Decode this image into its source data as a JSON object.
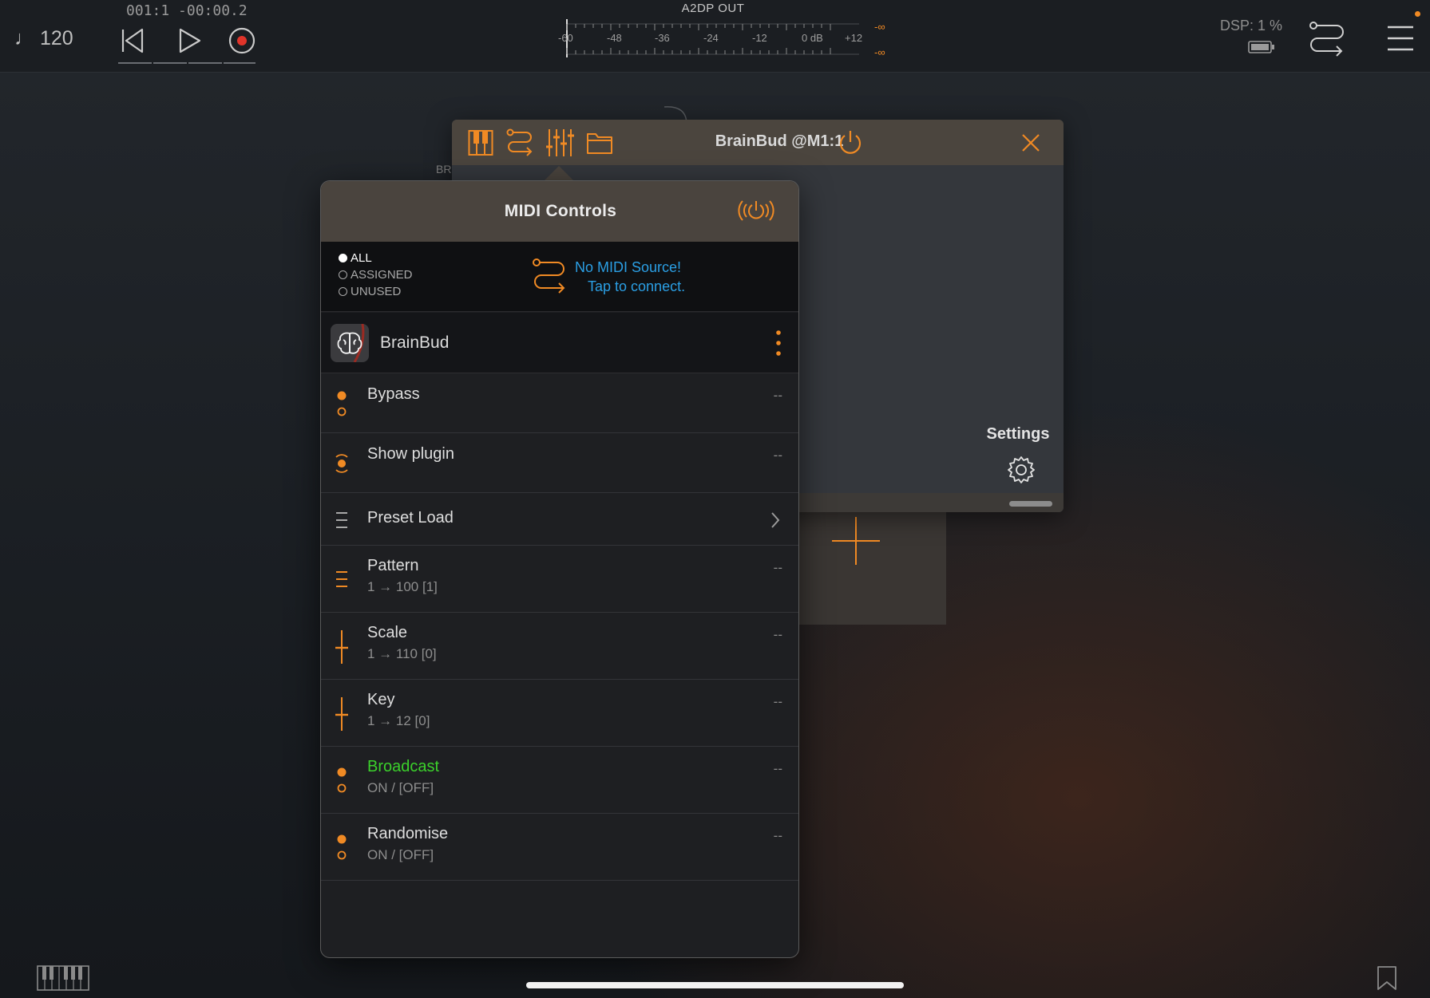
{
  "topbar": {
    "tempo": "♩ 120",
    "timecode": "001:1 -00:00.2",
    "meter_title": "A2DP OUT",
    "meter_labels": [
      "-60",
      "-48",
      "-36",
      "-24",
      "-12",
      "0 dB",
      "+12"
    ],
    "meter_peak": [
      "-∞",
      "-∞"
    ],
    "dsp": "DSP:  1 %"
  },
  "background": {
    "node_label": "BR"
  },
  "plugin_window": {
    "title": "BrainBud @M1:1",
    "settings_label": "Settings",
    "toolbar_icons": [
      "keyboard-icon",
      "routing-icon",
      "sliders-icon",
      "folder-icon"
    ]
  },
  "midi_panel": {
    "title": "MIDI Controls",
    "filters": [
      {
        "label": "ALL",
        "selected": true
      },
      {
        "label": "ASSIGNED",
        "selected": false
      },
      {
        "label": "UNUSED",
        "selected": false
      }
    ],
    "no_source_line1": "No MIDI Source!",
    "no_source_line2": "Tap to connect.",
    "plugin_name": "BrainBud",
    "controls": [
      {
        "name": "Bypass",
        "sub": "",
        "value": "--",
        "icon": "toggle-icon"
      },
      {
        "name": "Show plugin",
        "sub": "",
        "value": "--",
        "icon": "momentary-icon"
      },
      {
        "name": "Preset Load",
        "sub": "",
        "value": "",
        "icon": "list-icon",
        "chevron": true
      },
      {
        "name": "Pattern",
        "sub": "1 → 100 [1]",
        "value": "--",
        "icon": "list-icon"
      },
      {
        "name": "Scale",
        "sub": "1 → 110  [0]",
        "value": "--",
        "icon": "fader-icon"
      },
      {
        "name": "Key",
        "sub": "1 → 12  [0]",
        "value": "--",
        "icon": "fader-icon"
      },
      {
        "name": "Broadcast",
        "sub": "ON / [OFF]",
        "value": "--",
        "icon": "toggle-icon",
        "highlight": true
      },
      {
        "name": "Randomise",
        "sub": "ON / [OFF]",
        "value": "--",
        "icon": "toggle-icon"
      }
    ]
  },
  "colors": {
    "accent": "#f08a24",
    "link": "#2b9fe4",
    "highlight": "#3bd12b",
    "record": "#e0342a"
  }
}
